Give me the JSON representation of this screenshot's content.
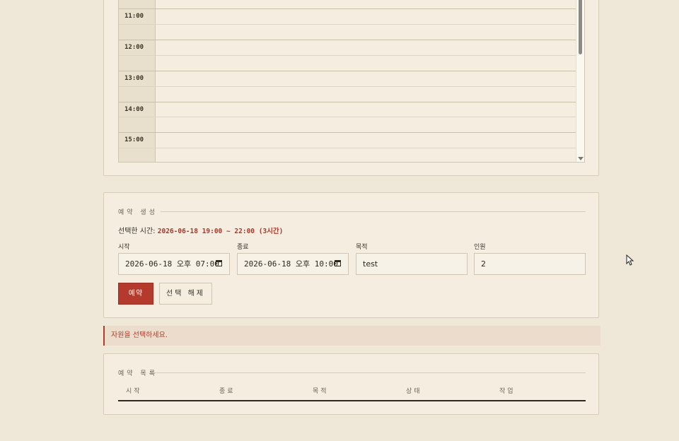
{
  "schedule": {
    "hours": [
      "11:00",
      "12:00",
      "13:00",
      "14:00",
      "15:00"
    ]
  },
  "form": {
    "legend": "예약 생성",
    "selected_label": "선택한 시간:",
    "selected_value": "2026-06-18 19:00 ~ 22:00 (3시간)",
    "fields": {
      "start": {
        "label": "시작",
        "value": "2026-06-18 오후 07:00"
      },
      "end": {
        "label": "종료",
        "value": "2026-06-18 오후 10:00"
      },
      "purpose": {
        "label": "목적",
        "value": "test"
      },
      "people": {
        "label": "인원",
        "value": "2"
      }
    },
    "reserve_label": "예약",
    "clear_label": "선택 해제"
  },
  "alert": {
    "message": "자원을 선택하세요."
  },
  "list": {
    "legend": "예약 목록",
    "columns": [
      "시작",
      "종료",
      "목적",
      "상태",
      "작업"
    ]
  },
  "colors": {
    "accent": "#b33a2d",
    "background": "#efe7d7",
    "card": "#f4ede0"
  }
}
